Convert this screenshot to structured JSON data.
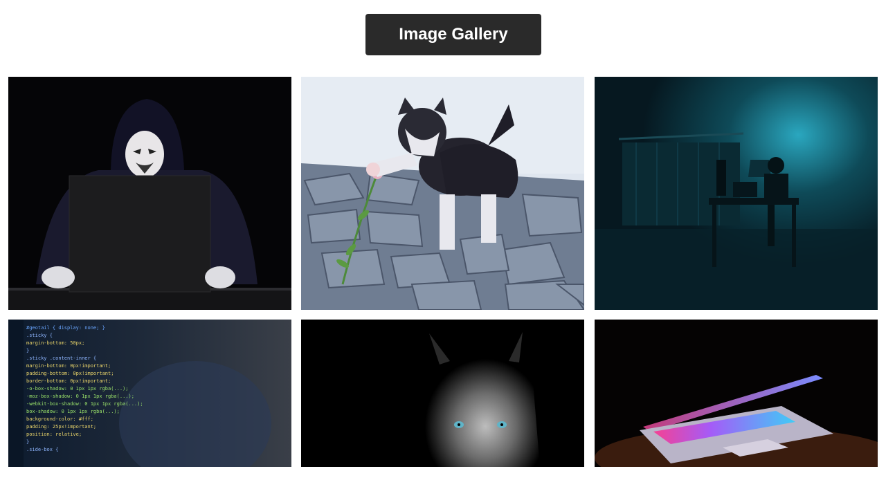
{
  "header": {
    "title": "Image Gallery"
  },
  "gallery": {
    "images": [
      {
        "subject": "hooded figure in mask at laptop"
      },
      {
        "subject": "kitten pawing a flower on cobblestones"
      },
      {
        "subject": "person at desk in dark teal-lit room"
      },
      {
        "subject": "code editor screen"
      },
      {
        "subject": "wolf in darkness"
      },
      {
        "subject": "glowing laptop keyboard"
      }
    ]
  },
  "code_lines": [
    "#geotail { display: none; }",
    ".sticky {",
    "  margin-bottom: 50px;",
    "}",
    ".sticky .content-inner {",
    "  margin-bottom: 0px!important;",
    "  padding-bottom: 0px!important;",
    "  border-bottom: 0px!important;",
    "  -o-box-shadow: 0 1px 1px rgba(...);",
    "  -moz-box-shadow: 0 1px 1px rgba(...);",
    "  -webkit-box-shadow: 0 1px 1px rgba(...);",
    "  box-shadow: 0 1px 1px rgba(...);",
    "  background-color: #fff;",
    "  padding: 25px!important;",
    "  position: relative;",
    "}",
    ".side-box {"
  ],
  "colors": {
    "title_bg": "#2a2a2a",
    "page_bg": "#ffffff"
  }
}
